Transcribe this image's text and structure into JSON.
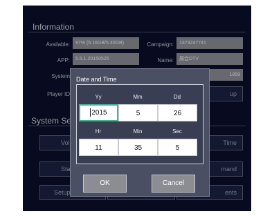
{
  "information": {
    "title": "Information",
    "available_label": "Available:",
    "available_value": "97% (5.16GB/5.30GB)",
    "campaign_label": "Campaign:",
    "campaign_value": "1373247741",
    "app_label": "APP:",
    "app_value": "5.5.1.20150525",
    "name_label": "Name:",
    "name_value": "展会DTV",
    "system_label": "System",
    "system_value_partial": "1859",
    "player_id_label": "Player ID",
    "setup_partial": "up"
  },
  "system_settings": {
    "title_partial": "System Set",
    "buttons": {
      "row1_left": "Vol",
      "row1_right": "Time",
      "row2_left": "Sta",
      "row2_right": "mand",
      "row3_left": "Setup",
      "row3_right": "ents"
    }
  },
  "dialog": {
    "title": "Date and Time",
    "headers_row1": [
      "Yy",
      "Mm",
      "Dd"
    ],
    "values_row1": [
      "2015",
      "5",
      "26"
    ],
    "headers_row2": [
      "Hr",
      "Min",
      "Sec"
    ],
    "values_row2": [
      "11",
      "35",
      "5"
    ],
    "ok_label": "OK",
    "cancel_label": "Cancel"
  },
  "colors": {
    "screen_bg": "#0b0f2a",
    "dialog_bg": "#4b4f63",
    "focus_border": "#3fb58f",
    "value_box": "#8b8d93"
  }
}
